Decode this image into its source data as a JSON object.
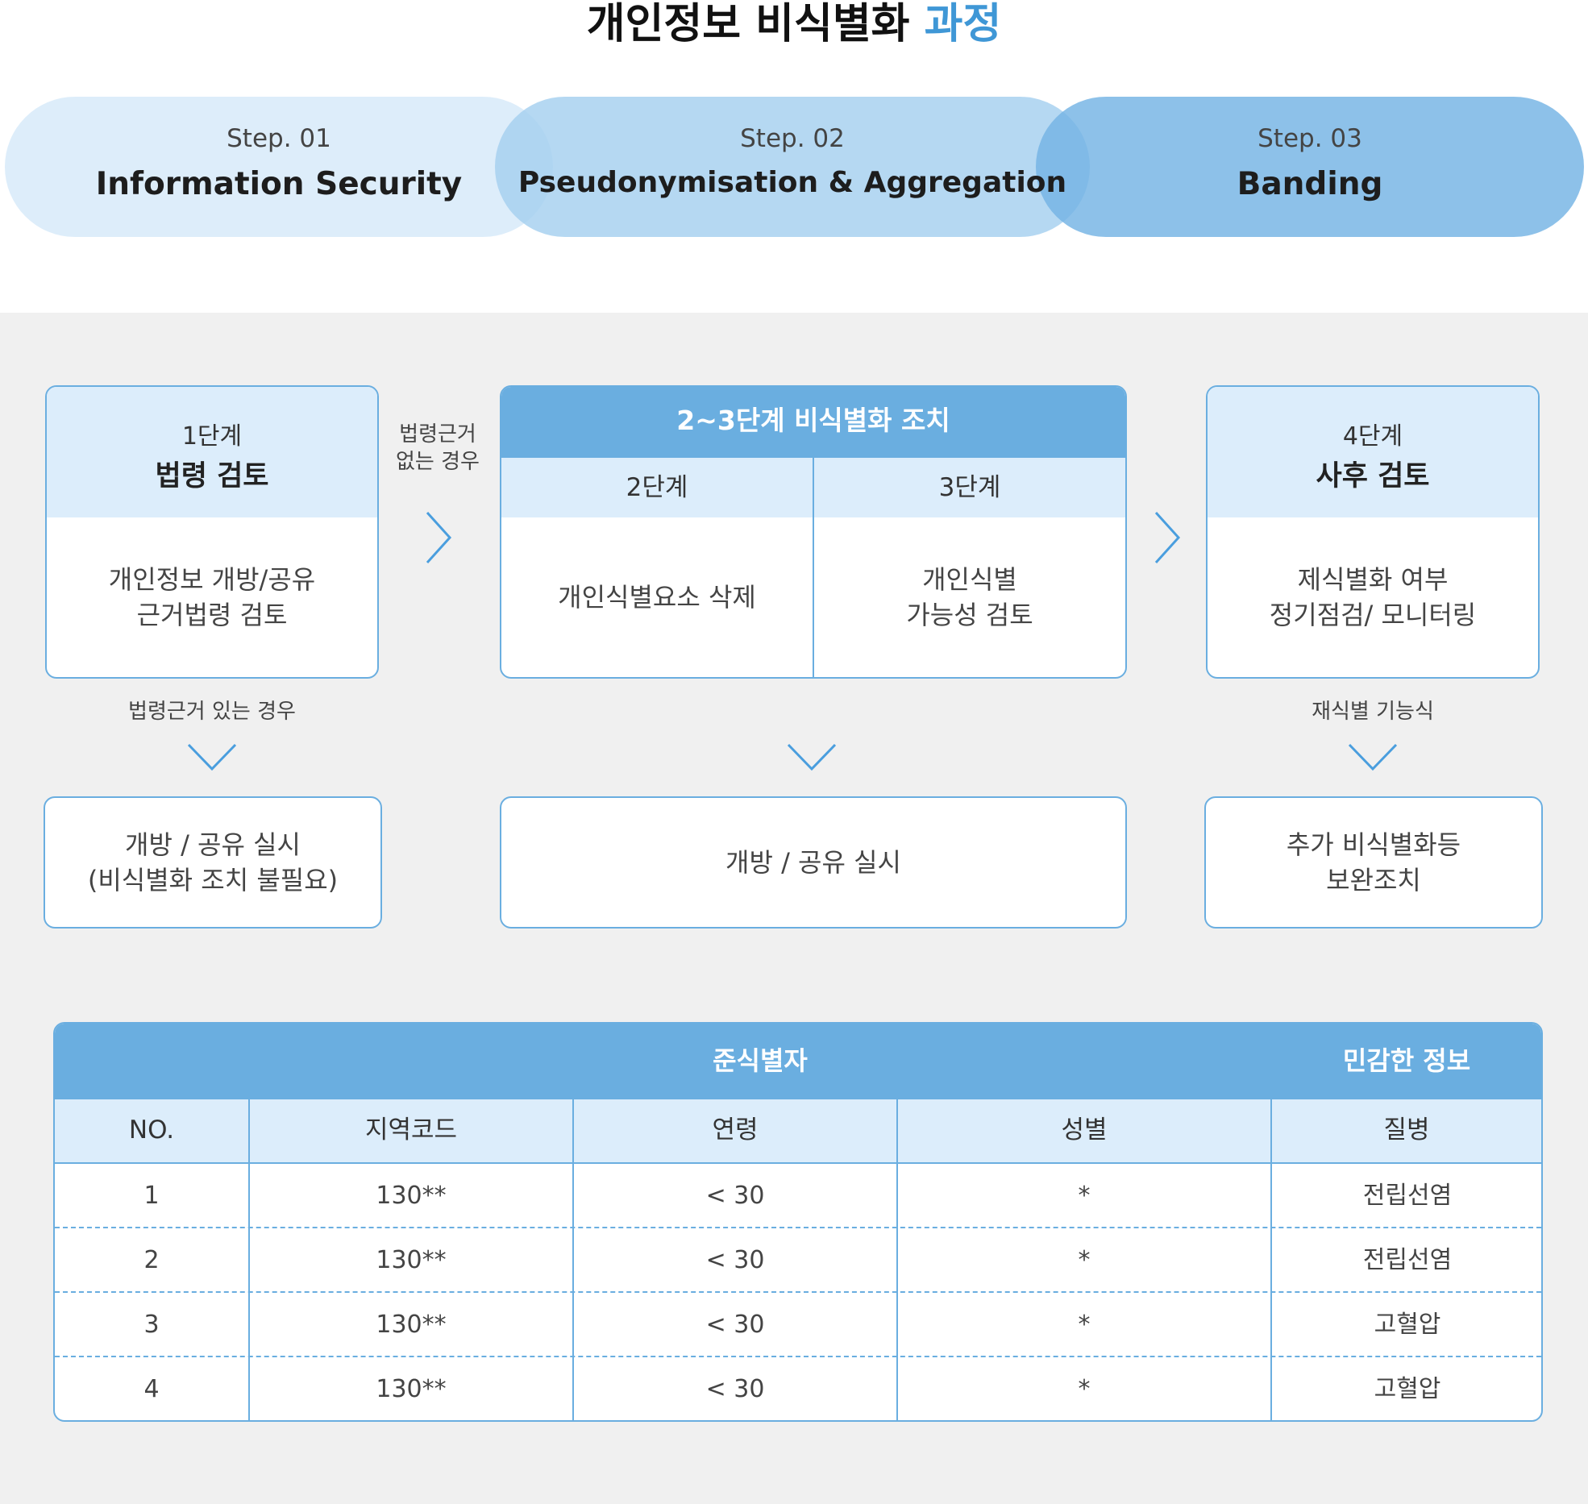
{
  "title": {
    "main": "개인정보 비식별화",
    "accent": "과정"
  },
  "colors": {
    "accent": "#3f97d6",
    "border": "#6aaee0",
    "light": "#dcedfb",
    "panel": "#f0f0f0"
  },
  "steps": [
    {
      "num": "Step. 01",
      "name": "Information Security"
    },
    {
      "num": "Step. 02",
      "name": "Pseudonymisation & Aggregation"
    },
    {
      "num": "Step. 03",
      "name": "Banding"
    }
  ],
  "process": {
    "stage1": {
      "label": "1단계",
      "title": "법령 검토",
      "body": "개인정보 개방/공유\n근거법령 검토"
    },
    "stage23": {
      "title": "2~3단계 비식별화 조치",
      "stage2": {
        "label": "2단계",
        "body": "개인식별요소 삭제"
      },
      "stage3": {
        "label": "3단계",
        "body": "개인식별\n가능성 검토"
      }
    },
    "stage4": {
      "label": "4단계",
      "title": "사후 검토",
      "body": "제식별화 여부\n정기점검/ 모니터링"
    },
    "notes": {
      "no_legal_basis": "법령근거\n없는 경우",
      "has_legal_basis": "법령근거 있는 경우",
      "reidentifiable": "재식별 기능식"
    },
    "outcomes": {
      "out1": "개방 / 공유 실시\n(비식별화 조치 불필요)",
      "out2": "개방 / 공유 실시",
      "out3": "추가 비식별화등\n보완조치"
    },
    "icons": [
      "chevron-right-icon",
      "chevron-down-icon"
    ]
  },
  "table": {
    "group_headers": {
      "quasi": "준식별자",
      "sensitive": "민감한 정보"
    },
    "columns": [
      "NO.",
      "지역코드",
      "연령",
      "성별",
      "질병"
    ],
    "rows": [
      [
        "1",
        "130**",
        "< 30",
        "*",
        "전립선염"
      ],
      [
        "2",
        "130**",
        "< 30",
        "*",
        "전립선염"
      ],
      [
        "3",
        "130**",
        "< 30",
        "*",
        "고혈압"
      ],
      [
        "4",
        "130**",
        "< 30",
        "*",
        "고혈압"
      ]
    ]
  }
}
